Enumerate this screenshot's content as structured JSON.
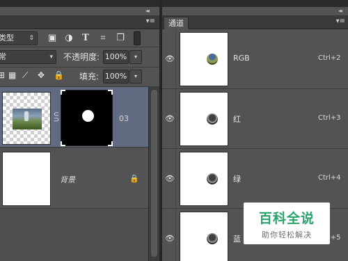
{
  "layers_panel": {
    "collapse_glyph": "◂◂",
    "menu_glyph": "▾≡",
    "filter": {
      "kind_label": "类型",
      "arrow": "⇕"
    },
    "filter_icons": [
      "image-filter-icon",
      "adjustment-filter-icon",
      "type-filter-icon",
      "shape-filter-icon",
      "smart-object-filter-icon",
      "filter-toggle-icon"
    ],
    "blend": {
      "mode": "常",
      "opacity_label": "不透明度:",
      "opacity_value": "100%",
      "arrow": "▾"
    },
    "lock": {
      "label": "锁定:",
      "fill_label": "填充:",
      "fill_value": "100%",
      "arrow": "▾"
    },
    "layers": [
      {
        "name": "03"
      },
      {
        "name": "背景"
      }
    ]
  },
  "channels_panel": {
    "collapse_glyph": "◂◂",
    "tab_label": "通道",
    "menu_glyph": "▾≡",
    "channels": [
      {
        "name": "RGB",
        "shortcut": "Ctrl+2"
      },
      {
        "name": "红",
        "shortcut": "Ctrl+3"
      },
      {
        "name": "绿",
        "shortcut": "Ctrl+4"
      },
      {
        "name": "蓝",
        "shortcut": "Ctrl+5"
      }
    ]
  },
  "watermark": {
    "title": "百科全说",
    "subtitle": "助你轻松解决"
  }
}
